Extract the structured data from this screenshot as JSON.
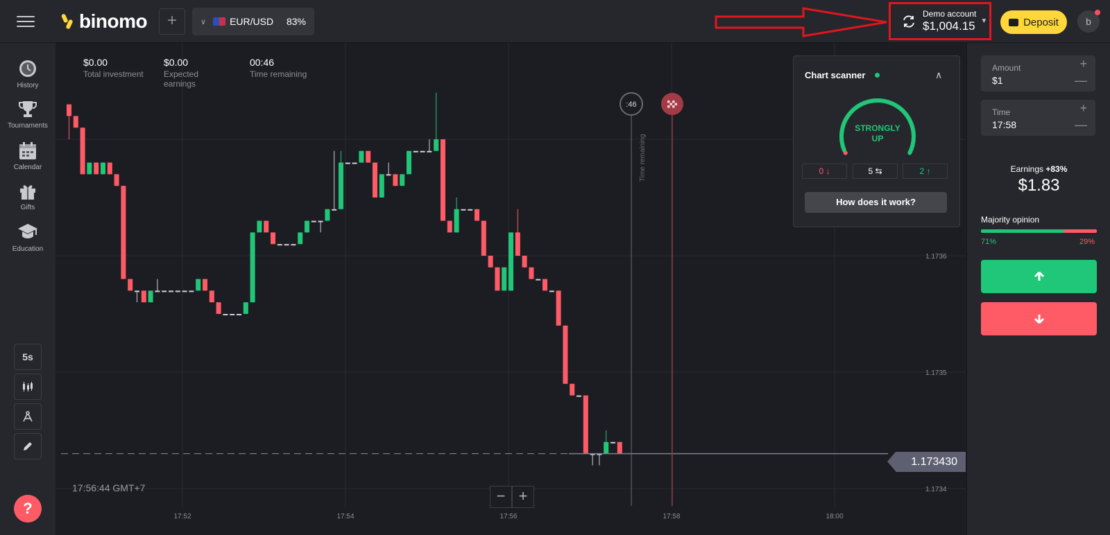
{
  "app": {
    "brand": "binomo"
  },
  "asset": {
    "name": "EUR/USD",
    "payout": "83%"
  },
  "account": {
    "label": "Demo account",
    "balance": "$1,004.15"
  },
  "header": {
    "deposit_label": "Deposit",
    "avatar_initial": "b"
  },
  "sidebar": {
    "items": [
      {
        "label": "History",
        "icon": "clock-icon"
      },
      {
        "label": "Tournaments",
        "icon": "trophy-icon"
      },
      {
        "label": "Calendar",
        "icon": "calendar-icon"
      },
      {
        "label": "Gifts",
        "icon": "gift-icon"
      },
      {
        "label": "Education",
        "icon": "graduation-cap-icon"
      }
    ],
    "tools": {
      "interval": "5s"
    },
    "help": "?"
  },
  "stats": [
    {
      "value": "$0.00",
      "label": "Total investment"
    },
    {
      "value": "$0.00",
      "label": "Expected earnings"
    },
    {
      "value": "00:46",
      "label": "Time remaining"
    }
  ],
  "chart_data": {
    "type": "candlestick",
    "x_ticks": [
      "17:52",
      "17:54",
      "17:56",
      "17:58",
      "18:00"
    ],
    "y_ticks": [
      "1.1736",
      "1.1735",
      "1.1734"
    ],
    "current_price": "1.173430",
    "clock": "17:56:44 GMT+7",
    "countdown_marker": ":46",
    "vertical_line_label": "Time remaining",
    "candles": [
      [
        1.17373,
        1.17373,
        1.1737,
        1.17372
      ],
      [
        1.17372,
        1.17371,
        1.17371,
        1.17371
      ],
      [
        1.17371,
        1.17371,
        1.17367,
        1.17367
      ],
      [
        1.17367,
        1.17368,
        1.17367,
        1.17368
      ],
      [
        1.17368,
        1.17368,
        1.17367,
        1.17367
      ],
      [
        1.17367,
        1.17368,
        1.17367,
        1.17368
      ],
      [
        1.17368,
        1.17368,
        1.17367,
        1.17367
      ],
      [
        1.17367,
        1.17367,
        1.17366,
        1.17366
      ],
      [
        1.17366,
        1.17366,
        1.17358,
        1.17358
      ],
      [
        1.17358,
        1.17358,
        1.17357,
        1.17357
      ],
      [
        1.17357,
        1.17357,
        1.17356,
        1.17357
      ],
      [
        1.17357,
        1.17357,
        1.17356,
        1.17356
      ],
      [
        1.17356,
        1.17357,
        1.17356,
        1.17357
      ],
      [
        1.17357,
        1.17358,
        1.17357,
        1.17357
      ],
      [
        1.17357,
        1.17357,
        1.17357,
        1.17357
      ],
      [
        1.17357,
        1.17357,
        1.17357,
        1.17357
      ],
      [
        1.17357,
        1.17357,
        1.17357,
        1.17357
      ],
      [
        1.17357,
        1.17357,
        1.17357,
        1.17357
      ],
      [
        1.17357,
        1.17357,
        1.17357,
        1.17357
      ],
      [
        1.17357,
        1.17358,
        1.17357,
        1.17358
      ],
      [
        1.17358,
        1.17358,
        1.17357,
        1.17357
      ],
      [
        1.17357,
        1.17357,
        1.17356,
        1.17356
      ],
      [
        1.17356,
        1.17356,
        1.17355,
        1.17355
      ],
      [
        1.17355,
        1.17355,
        1.17355,
        1.17355
      ],
      [
        1.17355,
        1.17355,
        1.17355,
        1.17355
      ],
      [
        1.17355,
        1.17355,
        1.17355,
        1.17355
      ],
      [
        1.17355,
        1.17356,
        1.17355,
        1.17356
      ],
      [
        1.17356,
        1.17362,
        1.17356,
        1.17362
      ],
      [
        1.17362,
        1.17363,
        1.17362,
        1.17363
      ],
      [
        1.17363,
        1.17363,
        1.17362,
        1.17362
      ],
      [
        1.17362,
        1.17362,
        1.17361,
        1.17361
      ],
      [
        1.17361,
        1.17361,
        1.17361,
        1.17361
      ],
      [
        1.17361,
        1.17361,
        1.17361,
        1.17361
      ],
      [
        1.17361,
        1.17361,
        1.17361,
        1.17361
      ],
      [
        1.17361,
        1.17362,
        1.17361,
        1.17362
      ],
      [
        1.17362,
        1.17363,
        1.17362,
        1.17363
      ],
      [
        1.17363,
        1.17363,
        1.17363,
        1.17363
      ],
      [
        1.17363,
        1.17363,
        1.17362,
        1.17363
      ],
      [
        1.17363,
        1.17364,
        1.17363,
        1.17364
      ],
      [
        1.17364,
        1.17369,
        1.17364,
        1.17364
      ],
      [
        1.17364,
        1.17369,
        1.17364,
        1.17368
      ],
      [
        1.17368,
        1.17368,
        1.17368,
        1.17368
      ],
      [
        1.17368,
        1.17368,
        1.17368,
        1.17368
      ],
      [
        1.17368,
        1.17369,
        1.17368,
        1.17369
      ],
      [
        1.17369,
        1.17369,
        1.17368,
        1.17368
      ],
      [
        1.17368,
        1.17368,
        1.17365,
        1.17365
      ],
      [
        1.17365,
        1.17367,
        1.17365,
        1.17367
      ],
      [
        1.17367,
        1.17368,
        1.17367,
        1.17367
      ],
      [
        1.17367,
        1.17367,
        1.17366,
        1.17366
      ],
      [
        1.17366,
        1.17367,
        1.17366,
        1.17367
      ],
      [
        1.17367,
        1.17369,
        1.17367,
        1.17369
      ],
      [
        1.17369,
        1.17369,
        1.17369,
        1.17369
      ],
      [
        1.17369,
        1.17369,
        1.17369,
        1.17369
      ],
      [
        1.17369,
        1.1737,
        1.17369,
        1.17369
      ],
      [
        1.17369,
        1.17374,
        1.17369,
        1.1737
      ],
      [
        1.1737,
        1.1737,
        1.17363,
        1.17363
      ],
      [
        1.17363,
        1.17363,
        1.17362,
        1.17362
      ],
      [
        1.17362,
        1.17365,
        1.17362,
        1.17364
      ],
      [
        1.17364,
        1.17364,
        1.17364,
        1.17364
      ],
      [
        1.17364,
        1.17364,
        1.17364,
        1.17364
      ],
      [
        1.17364,
        1.17364,
        1.17363,
        1.17363
      ],
      [
        1.17363,
        1.17363,
        1.1736,
        1.1736
      ],
      [
        1.1736,
        1.1736,
        1.17359,
        1.17359
      ],
      [
        1.17359,
        1.17359,
        1.17357,
        1.17357
      ],
      [
        1.17357,
        1.17359,
        1.17357,
        1.17359
      ],
      [
        1.17357,
        1.17362,
        1.17357,
        1.17362
      ],
      [
        1.17362,
        1.17364,
        1.1736,
        1.1736
      ],
      [
        1.1736,
        1.1736,
        1.17359,
        1.17359
      ],
      [
        1.17359,
        1.17359,
        1.17358,
        1.17358
      ],
      [
        1.17358,
        1.17358,
        1.17358,
        1.17358
      ],
      [
        1.17358,
        1.17358,
        1.17357,
        1.17357
      ],
      [
        1.17357,
        1.17357,
        1.17357,
        1.17357
      ],
      [
        1.17357,
        1.17357,
        1.17354,
        1.17354
      ],
      [
        1.17354,
        1.17354,
        1.17349,
        1.17349
      ],
      [
        1.17349,
        1.17349,
        1.17348,
        1.17348
      ],
      [
        1.17348,
        1.17348,
        1.17348,
        1.17348
      ],
      [
        1.17348,
        1.17348,
        1.17343,
        1.17343
      ],
      [
        1.17343,
        1.17343,
        1.17342,
        1.17343
      ],
      [
        1.17343,
        1.17343,
        1.17342,
        1.17343
      ],
      [
        1.17343,
        1.17345,
        1.17343,
        1.17344
      ],
      [
        1.17344,
        1.17344,
        1.17344,
        1.17344
      ],
      [
        1.17344,
        1.17344,
        1.17343,
        1.17343
      ]
    ],
    "colors": {
      "up": "#20c778",
      "down": "#ff5b67",
      "flat": "#d0d1d6"
    }
  },
  "scanner": {
    "title": "Chart scanner",
    "signal_line1": "STRONGLY",
    "signal_line2": "UP",
    "gauge_value": 0.78,
    "votes": {
      "down": "0",
      "neutral": "5",
      "up": "2"
    },
    "how_label": "How does it work?"
  },
  "trade": {
    "amount_label": "Amount",
    "amount_value": "$1",
    "time_label": "Time",
    "time_value": "17:58",
    "earnings_label": "Earnings",
    "earnings_pct": "+83%",
    "earnings_value": "$1.83",
    "majority_label": "Majority opinion",
    "majority_up": 0.71,
    "majority_up_text": "71%",
    "majority_down_text": "29%"
  },
  "zoom": {
    "minus": "−",
    "plus": "+"
  }
}
